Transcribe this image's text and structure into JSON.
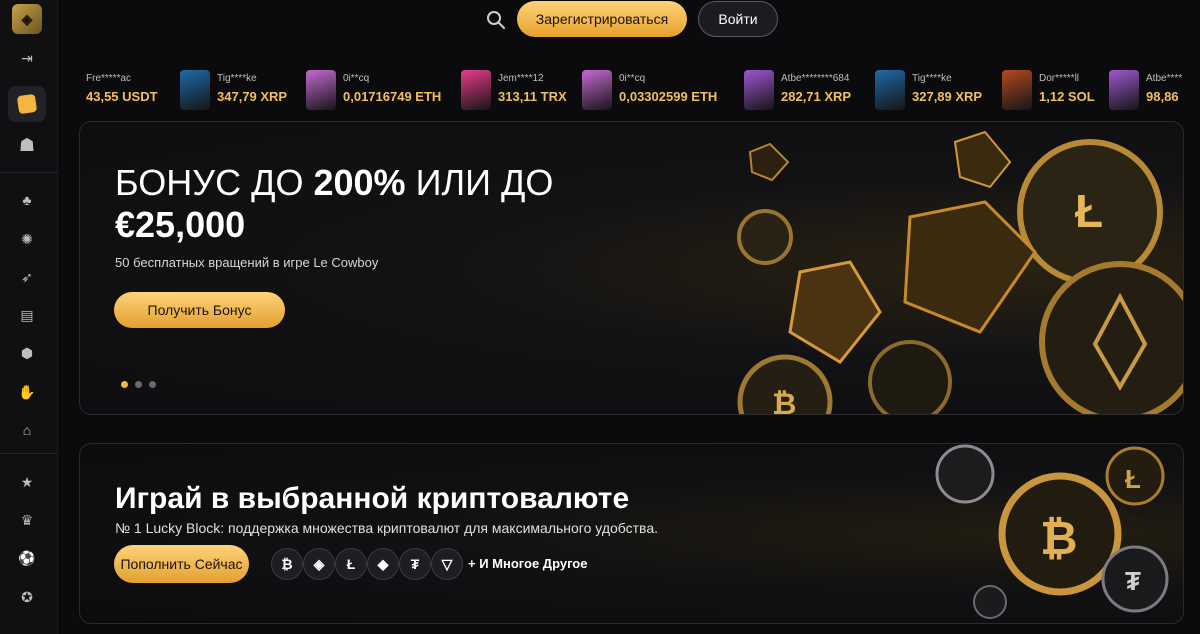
{
  "topbar": {
    "register_label": "Зарегистрироваться",
    "login_label": "Войти"
  },
  "ticker": [
    {
      "user": "Fre*****ac",
      "amount": "43,55 USDT",
      "thumb": "none"
    },
    {
      "user": "Tig****ke",
      "amount": "347,79 XRP",
      "thumb": "#1e6aa8"
    },
    {
      "user": "0i**cq",
      "amount": "0,01716749 ETH",
      "thumb": "#c66ad3"
    },
    {
      "user": "Jem****12",
      "amount": "313,11 TRX",
      "thumb": "#e83c8d"
    },
    {
      "user": "0i**cq",
      "amount": "0,03302599 ETH",
      "thumb": "#c66ad3"
    },
    {
      "user": "Atbe********684",
      "amount": "282,71 XRP",
      "thumb": "#9e57d1"
    },
    {
      "user": "Tig****ke",
      "amount": "327,89 XRP",
      "thumb": "#1e6aa8"
    },
    {
      "user": "Dor*****ll",
      "amount": "1,12 SOL",
      "thumb": "#b44a1e"
    },
    {
      "user": "Atbe****",
      "amount": "98,86",
      "thumb": "#9e57d1"
    }
  ],
  "hero": {
    "title_light_1": "БОНУС ДО ",
    "title_bold_1": "200%",
    "title_light_2": " ИЛИ ДО",
    "title_bold_2": "€25,000",
    "subtitle": "50 бесплатных вращений в игре Le Cowboy",
    "button_label": "Получить Бонус"
  },
  "crypto": {
    "title": "Играй в выбранной криптовалюте",
    "subtitle": "№ 1 Lucky Block: поддержка множества криптовалют для максимального удобства.",
    "button_label": "Пополнить Сейчас",
    "more_label": "+ И Многое Другое",
    "coins": [
      "₿",
      "◈",
      "Ł",
      "◆",
      "₮",
      "▽"
    ]
  },
  "colors": {
    "accent": "#f4b63f",
    "background": "#0b0b0d"
  }
}
